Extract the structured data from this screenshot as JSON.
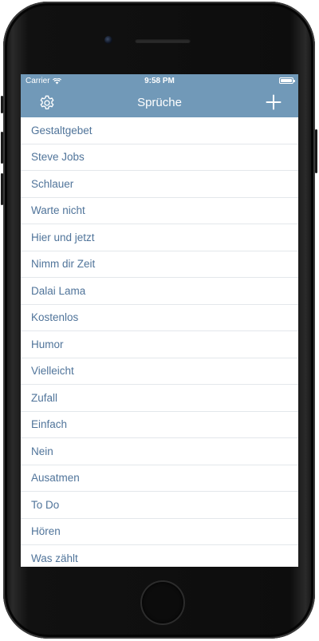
{
  "status_bar": {
    "carrier": "Carrier",
    "time": "9:58 PM"
  },
  "nav": {
    "title": "Sprüche"
  },
  "icons": {
    "settings": "gear-icon",
    "add": "plus-icon",
    "wifi": "wifi-icon",
    "battery": "battery-icon"
  },
  "colors": {
    "accent": "#7199b8",
    "item_text": "#50749a",
    "separator": "#e3e7eb"
  },
  "list_items": [
    "Gestaltgebet",
    "Steve Jobs",
    "Schlauer",
    "Warte nicht",
    "Hier und jetzt",
    "Nimm dir Zeit",
    "Dalai Lama",
    "Kostenlos",
    "Humor",
    "Vielleicht",
    "Zufall",
    "Einfach",
    "Nein",
    "Ausatmen",
    "To Do",
    "Hören",
    "Was zählt"
  ]
}
